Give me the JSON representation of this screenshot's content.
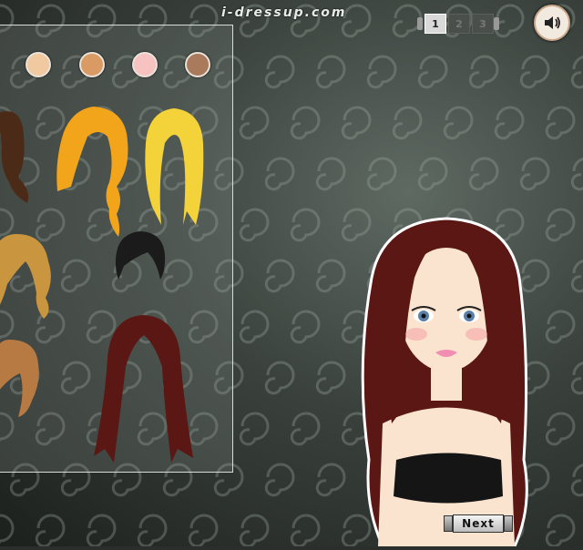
{
  "header": {
    "site_title": "i-dressup.com"
  },
  "page_nav": {
    "pages": [
      "1",
      "2",
      "3"
    ],
    "active_page": "1"
  },
  "sound": {
    "icon": "speaker-icon"
  },
  "palette": {
    "skin_tones": [
      "#f1c9a0",
      "#d99a63",
      "#f6c3c0",
      "#a97a5c"
    ]
  },
  "hair_options": [
    {
      "name": "brown-ponytail",
      "color": "#4b2b17"
    },
    {
      "name": "orange-twin-braids",
      "color": "#f2a51b"
    },
    {
      "name": "blonde-straight",
      "color": "#f3d23a"
    },
    {
      "name": "golden-waves",
      "color": "#c9953f"
    },
    {
      "name": "black-short",
      "color": "#1b1b1b"
    },
    {
      "name": "light-brown-bob",
      "color": "#b77a42"
    },
    {
      "name": "dark-red-long",
      "color": "#5a1713"
    }
  ],
  "model": {
    "hair_color": "#5a1713",
    "skin": "#fbe4cf",
    "eyes": "#5c7fa8",
    "lips": "#f08db0",
    "top_color": "#151515"
  },
  "next_button": {
    "label": "Next"
  }
}
